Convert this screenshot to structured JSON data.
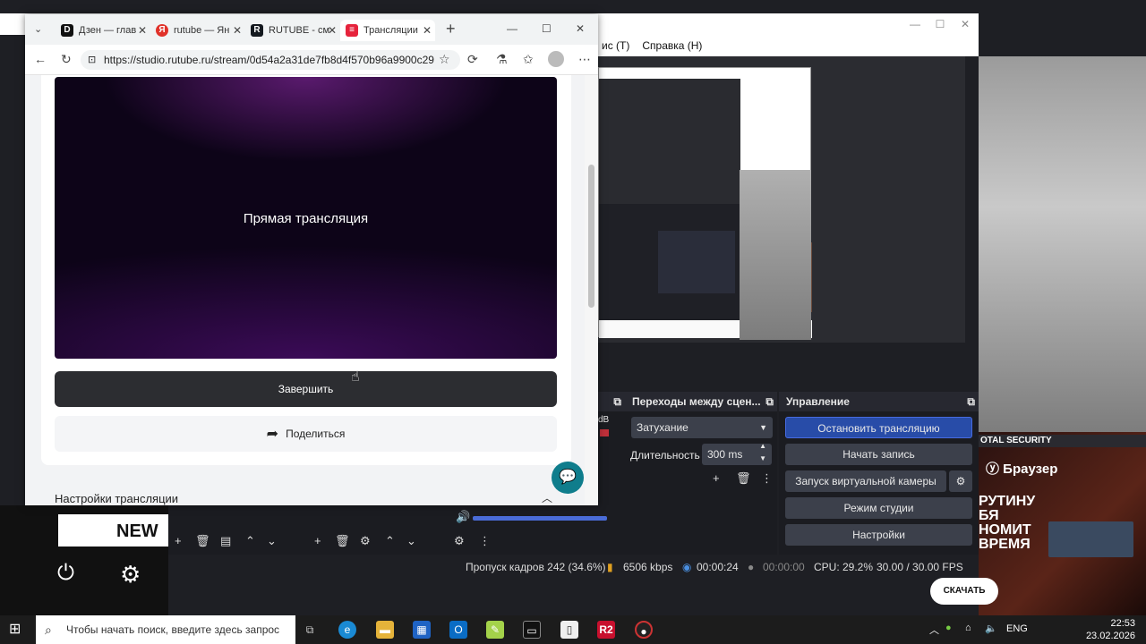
{
  "browser": {
    "tabs": [
      {
        "label": "Дзен — глав",
        "fav": "D",
        "color": "#111111"
      },
      {
        "label": "rutube — Ян",
        "fav": "Я",
        "color": "#e0322a"
      },
      {
        "label": "RUTUBE - см",
        "fav": "R",
        "color": "#14191f"
      },
      {
        "label": "Трансляции",
        "fav": "≡",
        "color": "#e6233c"
      }
    ],
    "new_tab": "+",
    "url": "https://studio.rutube.ru/stream/0d54a2a31de7fb8d4f570b96a9900c29",
    "window_controls": {
      "minimize": "—",
      "maximize": "☐",
      "close": "✕"
    }
  },
  "page": {
    "video_label": "Прямая трансляция",
    "end_button": "Завершить",
    "share_button": "Поделиться",
    "settings_heading": "Настройки трансляции"
  },
  "obs": {
    "menu": [
      "ис (T)",
      "Справка (H)"
    ],
    "transitions": {
      "title": "Переходы между сцен...",
      "type": "Затухание",
      "duration_label": "Длительность",
      "duration_value": "300 ms"
    },
    "controls": {
      "title": "Управление",
      "stop_stream": "Остановить трансляцию",
      "start_record": "Начать запись",
      "virtual_cam": "Запуск виртуальной камеры",
      "studio_mode": "Режим студии",
      "settings": "Настройки"
    },
    "status": {
      "dropped": "Пропуск кадров 242 (34.6%)",
      "bitrate": "6506 kbps",
      "stream_time": "00:00:24",
      "record_time": "00:00:00",
      "cpu": "CPU: 29.2%",
      "fps": "30.00 / 30.00 FPS"
    },
    "mixer_db": "dB"
  },
  "overlay": {
    "ad_security": "OTAL SECURITY",
    "ad_browser": "Браузер",
    "ad_text": [
      "РУТИНУ",
      "БЯ",
      "НОМИТ",
      "ВРЕМЯ"
    ],
    "download": "СКАЧАТЬ",
    "thumb_label": "NEW"
  },
  "taskbar": {
    "search_placeholder": "Чтобы начать поиск, введите здесь запрос",
    "lang": "ENG",
    "time": "22:53",
    "date": "23.02.2026"
  }
}
